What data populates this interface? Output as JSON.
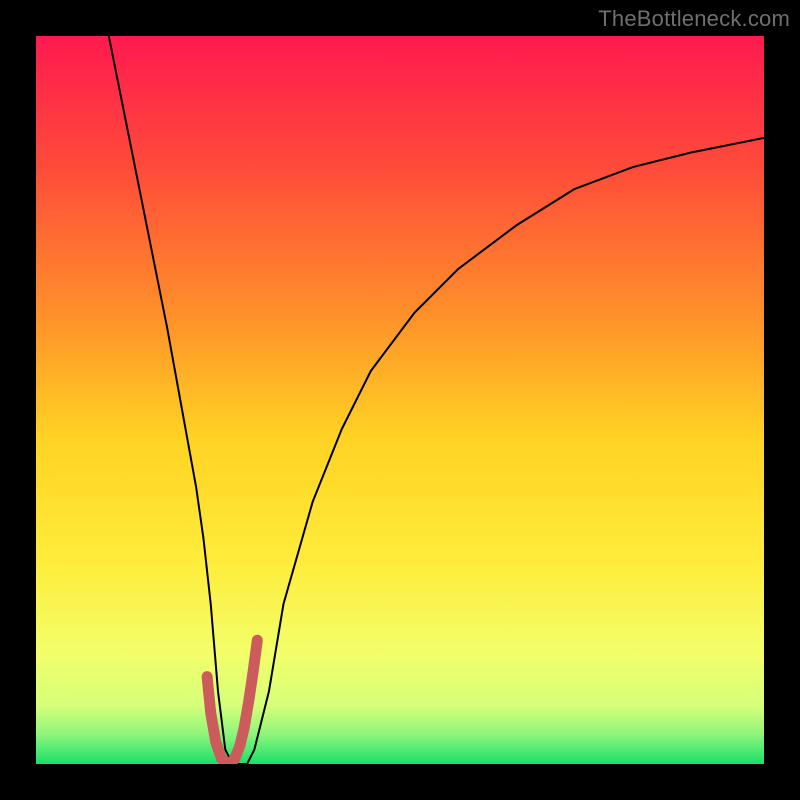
{
  "watermark": {
    "text": "TheBottleneck.com"
  },
  "icon_name": "bottleneck-curve-chart",
  "chart_data": {
    "type": "line",
    "title": "",
    "xlabel": "",
    "ylabel": "",
    "xlim": [
      0,
      100
    ],
    "ylim": [
      0,
      100
    ],
    "gradient_stops": [
      {
        "offset": 0.0,
        "color": "#ff1a4f"
      },
      {
        "offset": 0.18,
        "color": "#ff4b3a"
      },
      {
        "offset": 0.38,
        "color": "#ff8f2a"
      },
      {
        "offset": 0.55,
        "color": "#ffd223"
      },
      {
        "offset": 0.72,
        "color": "#ffec3a"
      },
      {
        "offset": 0.85,
        "color": "#f2ff6a"
      },
      {
        "offset": 0.92,
        "color": "#d6ff7a"
      },
      {
        "offset": 0.96,
        "color": "#8cf57a"
      },
      {
        "offset": 1.0,
        "color": "#18e06b"
      }
    ],
    "series": [
      {
        "name": "bottleneck-curve",
        "stroke": "#000000",
        "stroke_width": 2,
        "x": [
          10,
          12,
          14,
          16,
          18,
          20,
          22,
          23,
          24,
          25,
          26,
          27,
          28,
          29,
          30,
          32,
          34,
          38,
          42,
          46,
          52,
          58,
          66,
          74,
          82,
          90,
          100
        ],
        "values": [
          100,
          90,
          80,
          70,
          60,
          49,
          38,
          31,
          22,
          10,
          2,
          0,
          0,
          0,
          2,
          10,
          22,
          36,
          46,
          54,
          62,
          68,
          74,
          79,
          82,
          84,
          86
        ]
      }
    ],
    "floor_highlight": {
      "name": "min-segment",
      "stroke": "#cc5c5c",
      "stroke_width": 11,
      "x": [
        23.5,
        24.0,
        24.7,
        25.5,
        26.5,
        27.3,
        28.0,
        28.6,
        29.2,
        29.8,
        30.4
      ],
      "values": [
        12.0,
        7.0,
        3.0,
        0.7,
        0.0,
        0.7,
        2.5,
        5.0,
        8.5,
        12.5,
        17.0
      ]
    }
  }
}
